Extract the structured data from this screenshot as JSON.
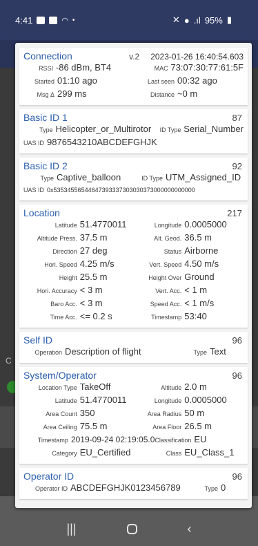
{
  "status_bar": {
    "time": "4:41",
    "battery": "95%"
  },
  "connection": {
    "title": "Connection",
    "version": "v.2",
    "datetime": "2023-01-26 16:40:54.603",
    "rssi_label": "RSSI",
    "rssi_value": "-86 dBm, BT4",
    "mac_label": "MAC",
    "mac_value": "73:07:30:77:61:5F",
    "started_label": "Started",
    "started_value": "01:10  ago",
    "last_seen_label": "Last seen",
    "last_seen_value": "00:32  ago",
    "msg_label": "Msg Δ",
    "msg_value": "299 ms",
    "distance_label": "Distance",
    "distance_value": "~0 m"
  },
  "basic_id_1": {
    "title": "Basic ID 1",
    "count": "87",
    "type_label": "Type",
    "type_value": "Helicopter_or_Multirotor",
    "id_type_label": "ID Type",
    "id_type_value": "Serial_Number",
    "uas_id_label": "UAS ID",
    "uas_id_value": "9876543210ABCDEFGHJK"
  },
  "basic_id_2": {
    "title": "Basic ID 2",
    "count": "92",
    "type_label": "Type",
    "type_value": "Captive_balloon",
    "id_type_label": "ID Type",
    "id_type_value": "UTM_Assigned_ID",
    "uas_id_label": "UAS ID",
    "uas_id_value": "0x53534556544647393337303030373000000000000"
  },
  "location": {
    "title": "Location",
    "count": "217",
    "rows": [
      {
        "l1": "Latitude",
        "v1": "51.4770011",
        "l2": "Longitude",
        "v2": "0.0005000"
      },
      {
        "l1": "Altitude Press.",
        "v1": "37.5 m",
        "l2": "Alt. Geod.",
        "v2": "36.5 m"
      },
      {
        "l1": "Direction",
        "v1": "27 deg",
        "l2": "Status",
        "v2": "Airborne"
      },
      {
        "l1": "Hori. Speed",
        "v1": "4.25 m/s",
        "l2": "Vert. Speed",
        "v2": "4.50 m/s"
      },
      {
        "l1": "Height",
        "v1": "25.5 m",
        "l2": "Height Over",
        "v2": "Ground"
      },
      {
        "l1": "Hori. Accuracy",
        "v1": "< 3 m",
        "l2": "Vert. Acc.",
        "v2": "< 1 m"
      },
      {
        "l1": "Baro Acc.",
        "v1": "< 3 m",
        "l2": "Speed Acc.",
        "v2": "< 1 m/s"
      },
      {
        "l1": "Time Acc.",
        "v1": "<= 0.2 s",
        "l2": "Timestamp",
        "v2": "53:40"
      }
    ]
  },
  "self_id": {
    "title": "Self ID",
    "count": "96",
    "operation_label": "Operation",
    "operation_value": "Description of flight",
    "type_label": "Type",
    "type_value": "Text"
  },
  "system_operator": {
    "title": "System/Operator",
    "count": "96",
    "rows": [
      {
        "l1": "Location Type",
        "v1": "TakeOff",
        "l2": "Altitude",
        "v2": "2.0 m"
      },
      {
        "l1": "Latitude",
        "v1": "51.4770011",
        "l2": "Longitude",
        "v2": "0.0005000"
      },
      {
        "l1": "Area Count",
        "v1": "350",
        "l2": "Area Radius",
        "v2": "50 m"
      },
      {
        "l1": "Area Ceiling",
        "v1": "75.5 m",
        "l2": "Area Floor",
        "v2": "26.5 m"
      },
      {
        "l1": "Timestamp",
        "v1": "2019-09-24 02:19:05.0",
        "l2": "Classification",
        "v2": "EU"
      },
      {
        "l1": "Category",
        "v1": "EU_Certified",
        "l2": "Class",
        "v2": "EU_Class_1"
      }
    ]
  },
  "operator_id": {
    "title": "Operator ID",
    "count": "96",
    "id_label": "Operator ID",
    "id_value": "ABCDEFGHJK0123456789",
    "type_label": "Type",
    "type_value": "0"
  },
  "behind": {
    "letter": "C"
  }
}
